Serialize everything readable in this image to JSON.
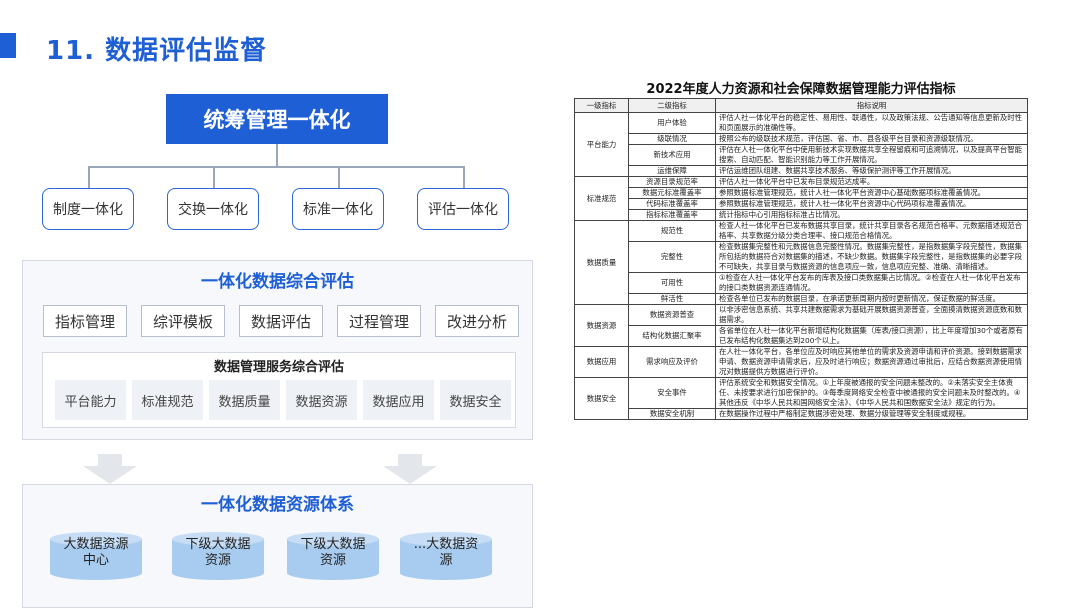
{
  "page": {
    "title": "11. 数据评估监督"
  },
  "diagram": {
    "top_box": "统筹管理一体化",
    "pills": [
      "制度一体化",
      "交换一体化",
      "标准一体化",
      "评估一体化"
    ],
    "panel1": {
      "heading": "一体化数据综合评估",
      "tools": [
        "指标管理",
        "综评模板",
        "数据评估",
        "过程管理",
        "改进分析"
      ],
      "inner_heading": "数据管理服务综合评估",
      "capabilities": [
        "平台能力",
        "标准规范",
        "数据质量",
        "数据资源",
        "数据应用",
        "数据安全"
      ]
    },
    "panel2": {
      "heading": "一体化数据资源体系",
      "cylinders": [
        {
          "line1": "大数据资源",
          "line2": "中心"
        },
        {
          "line1": "下级大数据",
          "line2": "资源"
        },
        {
          "line1": "下级大数据",
          "line2": "资源"
        },
        {
          "line1": "...大数据资",
          "line2": "源"
        }
      ]
    },
    "colors": {
      "accent": "#1f5fd6",
      "cylinder": "#a8ccf0"
    }
  },
  "table": {
    "title": "2022年度人力资源和社会保障数据管理能力评估指标",
    "headers": [
      "一级指标",
      "二级指标",
      "指标说明"
    ],
    "groups": [
      {
        "name": "平台能力",
        "rows": [
          {
            "sub": "用户体验",
            "desc": "评估人社一体化平台的稳定性、易用性、联通性，以及政策法规、公告通知等信息更新及时性和页面展示的准确性等。"
          },
          {
            "sub": "级联情况",
            "desc": "按照公布的级联技术规范，评估国、省、市、县各级平台目录和资源级联情况。"
          },
          {
            "sub": "新技术应用",
            "desc": "评估在人社一体化平台中使用新技术实现数据共享全程留痕和可追溯情况，以及提高平台智能搜索、自动匹配、智能识别能力等工作开展情况。"
          },
          {
            "sub": "运维保障",
            "desc": "评估运维团队组建、数据共享技术服务、等级保护测评等工作开展情况。"
          }
        ]
      },
      {
        "name": "标准规范",
        "rows": [
          {
            "sub": "资源目录规范率",
            "desc": "评估人社一体化平台中已发布目录规范达成率。"
          },
          {
            "sub": "数据元标准覆盖率",
            "desc": "参照数据标准管理规范，统计人社一体化平台资源中心基础数据项标准覆盖情况。"
          },
          {
            "sub": "代码标准覆盖率",
            "desc": "参照数据标准管理规范，统计人社一体化平台资源中心代码项标准覆盖情况。"
          },
          {
            "sub": "指标标准覆盖率",
            "desc": "统计指标中心引用指标标准占比情况。"
          }
        ]
      },
      {
        "name": "数据质量",
        "rows": [
          {
            "sub": "规范性",
            "desc": "检查人社一体化平台已发布数据共享目录，统计共享目录各名规范合格率、元数据描述规范合格率、共享数据分级分类合理率、接口规范合格情况。"
          },
          {
            "sub": "完整性",
            "desc": "检查数据集完整性和元数据信息完整性情况。数据集完整性，是指数据集字段完整性，数据集所包括的数据符合对数据集的描述，不缺少数据。数据集字段完整性，是指数据集的必要字段不可缺失，共享目录与数据资源的信息项应一致，信息项应完整、准确、清晰描述。"
          },
          {
            "sub": "可用性",
            "desc": "①检查在人社一体化平台发布的库表及接口类数据集占比情况。②检查在人社一体化平台发布的接口类数据资源连通情况。"
          },
          {
            "sub": "鲜活性",
            "desc": "检查各单位已发布的数据目录，在承诺更新周期内按时更新情况，保证数据的鲜活度。"
          }
        ]
      },
      {
        "name": "数据资源",
        "rows": [
          {
            "sub": "数据资源普查",
            "desc": "以非涉密信息系统、共享共建数据需求为基础开展数据资源普查，全面摸清数据资源底数和数据需求。"
          },
          {
            "sub": "结构化数据汇聚率",
            "desc": "各省单位在人社一体化平台新增结构化数据集（库表/接口资源），比上年度增加30个或者原有已发布结构化数据集达到200个以上。"
          }
        ]
      },
      {
        "name": "数据应用",
        "rows": [
          {
            "sub": "需求响应及评价",
            "desc": "在人社一体化平台，各单位应及时响应其他单位的需求及资源申请和评价资源。接到数据需求申请、数据资源申请需求后，应及时进行响应；数据资源通过审批后，应结合数据资源使用情况对数据提供方数据进行评价。"
          }
        ]
      },
      {
        "name": "数据安全",
        "rows": [
          {
            "sub": "安全事件",
            "desc": "评估系统安全和数据安全情况。①上年度被通报的安全问题未整改的。②未落实安全主体责任、未按要求进行加密保护的。③每季度网络安全检查中被通报的安全问题未及时整改的。④其他违反《中华人民共和国网络安全法》、《中华人民共和国数据安全法》规定的行为。"
          },
          {
            "sub": "数据安全机制",
            "desc": "在数据操作过程中严格制定数据涉密处理、数据分级管理等安全制度或规程。"
          }
        ]
      }
    ]
  }
}
